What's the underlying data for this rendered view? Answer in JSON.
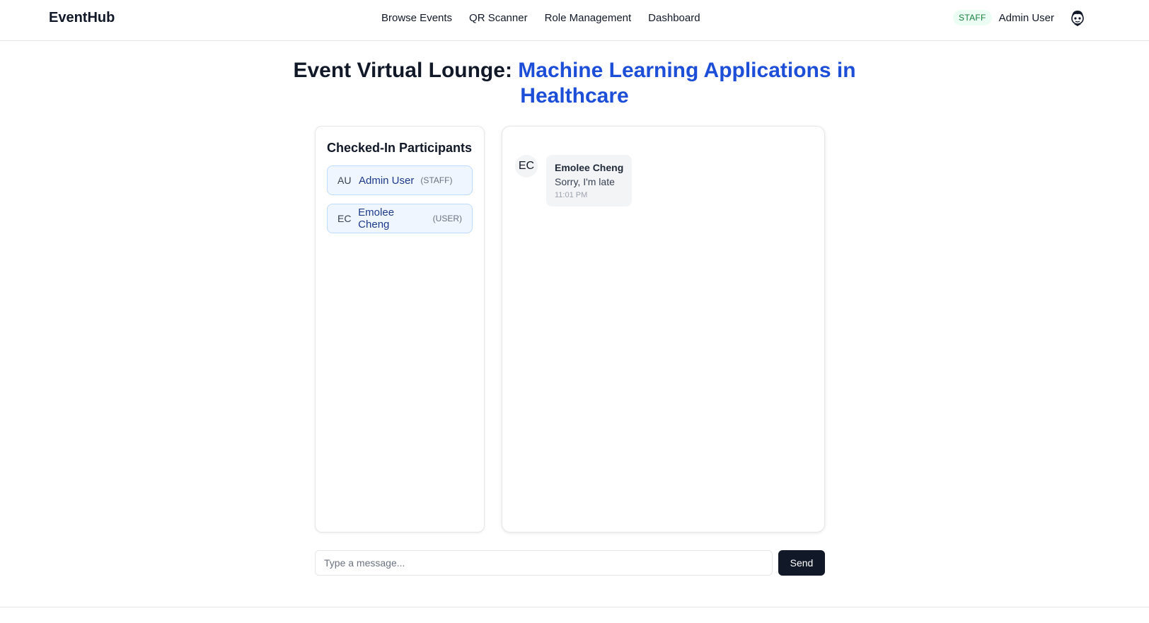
{
  "nav": {
    "brand": "EventHub",
    "links": [
      "Browse Events",
      "QR Scanner",
      "Role Management",
      "Dashboard"
    ],
    "role_badge": "STAFF",
    "user_name": "Admin User",
    "avatar_icon": "user-avatar-icon"
  },
  "page": {
    "title_prefix": "Event Virtual Lounge: ",
    "event_name": "Machine Learning Applications in Healthcare"
  },
  "participants": {
    "title": "Checked-In Participants",
    "items": [
      {
        "initials": "AU",
        "name": "Admin User",
        "role": "(STAFF)"
      },
      {
        "initials": "EC",
        "name": "Emolee Cheng",
        "role": "(USER)"
      }
    ]
  },
  "chat": {
    "messages": [
      {
        "initials": "EC",
        "author": "Emolee Cheng",
        "text": "Sorry, I'm late",
        "time": "11:01 PM"
      }
    ]
  },
  "composer": {
    "placeholder": "Type a message...",
    "value": "",
    "send_label": "Send"
  },
  "colors": {
    "accent": "#1d4ed8",
    "badge_bg": "#ecfdf3",
    "badge_text": "#15803d",
    "send_button": "#111827"
  }
}
